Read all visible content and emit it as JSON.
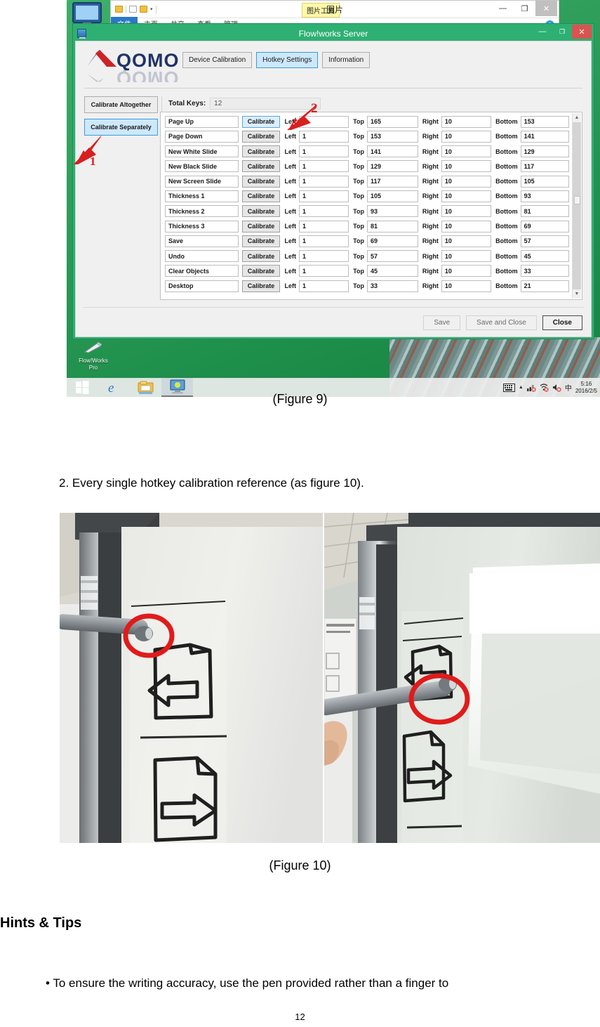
{
  "document": {
    "figure9_caption": "(Figure 9)",
    "step2": "2.  Every single hotkey calibration reference (as figure 10).",
    "figure10_caption": "(Figure 10)",
    "hints_heading": "Hints & Tips",
    "hint_bullet": "• To ensure the writing accuracy, use the pen provided rather than a finger to",
    "page_number": "12"
  },
  "explorer_window": {
    "title": "图片",
    "context_tab": "图片工具",
    "ribbon_tabs": [
      "文件",
      "主页",
      "共享",
      "查看",
      "管理"
    ],
    "active_ribbon_tab": "文件",
    "controls": {
      "minimize": "—",
      "maximize": "❐",
      "close": "✕"
    }
  },
  "dialog": {
    "title": "Flow!works Server",
    "controls": {
      "minimize": "—",
      "maximize": "❐",
      "close": "✕"
    },
    "brand": "QOMO",
    "tabs": [
      {
        "label": "Device Calibration",
        "active": false
      },
      {
        "label": "Hotkey Settings",
        "active": true
      },
      {
        "label": "Information",
        "active": false
      }
    ],
    "sidebar": [
      {
        "label": "Calibrate Altogether",
        "active": false
      },
      {
        "label": "Calibrate Separately",
        "active": true
      }
    ],
    "total_keys": {
      "label": "Total Keys:",
      "value": "12"
    },
    "column_labels": {
      "calibrate": "Calibrate",
      "left": "Left",
      "top": "Top",
      "right": "Right",
      "bottom": "Bottom"
    },
    "rows": [
      {
        "name": "Page Up",
        "calibrate": "Calibrate",
        "left": "1",
        "top": "165",
        "right": "10",
        "bottom": "153"
      },
      {
        "name": "Page Down",
        "calibrate": "Calibrate",
        "left": "1",
        "top": "153",
        "right": "10",
        "bottom": "141"
      },
      {
        "name": "New White Slide",
        "calibrate": "Calibrate",
        "left": "1",
        "top": "141",
        "right": "10",
        "bottom": "129"
      },
      {
        "name": "New Black Slide",
        "calibrate": "Calibrate",
        "left": "1",
        "top": "129",
        "right": "10",
        "bottom": "117"
      },
      {
        "name": "New Screen Slide",
        "calibrate": "Calibrate",
        "left": "1",
        "top": "117",
        "right": "10",
        "bottom": "105"
      },
      {
        "name": "Thickness 1",
        "calibrate": "Calibrate",
        "left": "1",
        "top": "105",
        "right": "10",
        "bottom": "93"
      },
      {
        "name": "Thickness 2",
        "calibrate": "Calibrate",
        "left": "1",
        "top": "93",
        "right": "10",
        "bottom": "81"
      },
      {
        "name": "Thickness 3",
        "calibrate": "Calibrate",
        "left": "1",
        "top": "81",
        "right": "10",
        "bottom": "69"
      },
      {
        "name": "Save",
        "calibrate": "Calibrate",
        "left": "1",
        "top": "69",
        "right": "10",
        "bottom": "57"
      },
      {
        "name": "Undo",
        "calibrate": "Calibrate",
        "left": "1",
        "top": "57",
        "right": "10",
        "bottom": "45"
      },
      {
        "name": "Clear Objects",
        "calibrate": "Calibrate",
        "left": "1",
        "top": "45",
        "right": "10",
        "bottom": "33"
      },
      {
        "name": "Desktop",
        "calibrate": "Calibrate",
        "left": "1",
        "top": "33",
        "right": "10",
        "bottom": "21"
      }
    ],
    "footer_buttons": [
      {
        "label": "Save",
        "primary": false
      },
      {
        "label": "Save and Close",
        "primary": false
      },
      {
        "label": "Close",
        "primary": true
      }
    ],
    "annotations": [
      {
        "number": "1",
        "target": "Calibrate Separately"
      },
      {
        "number": "2",
        "target": "Calibrate button of first row"
      }
    ],
    "annotation_color": "#d81f1f"
  },
  "desktop": {
    "icon_label_line1": "Flow!Works",
    "icon_label_line2": "Pro"
  },
  "taskbar": {
    "ime_indicator": "中",
    "clock_time": "5:16",
    "clock_date": "2016/2/5"
  }
}
